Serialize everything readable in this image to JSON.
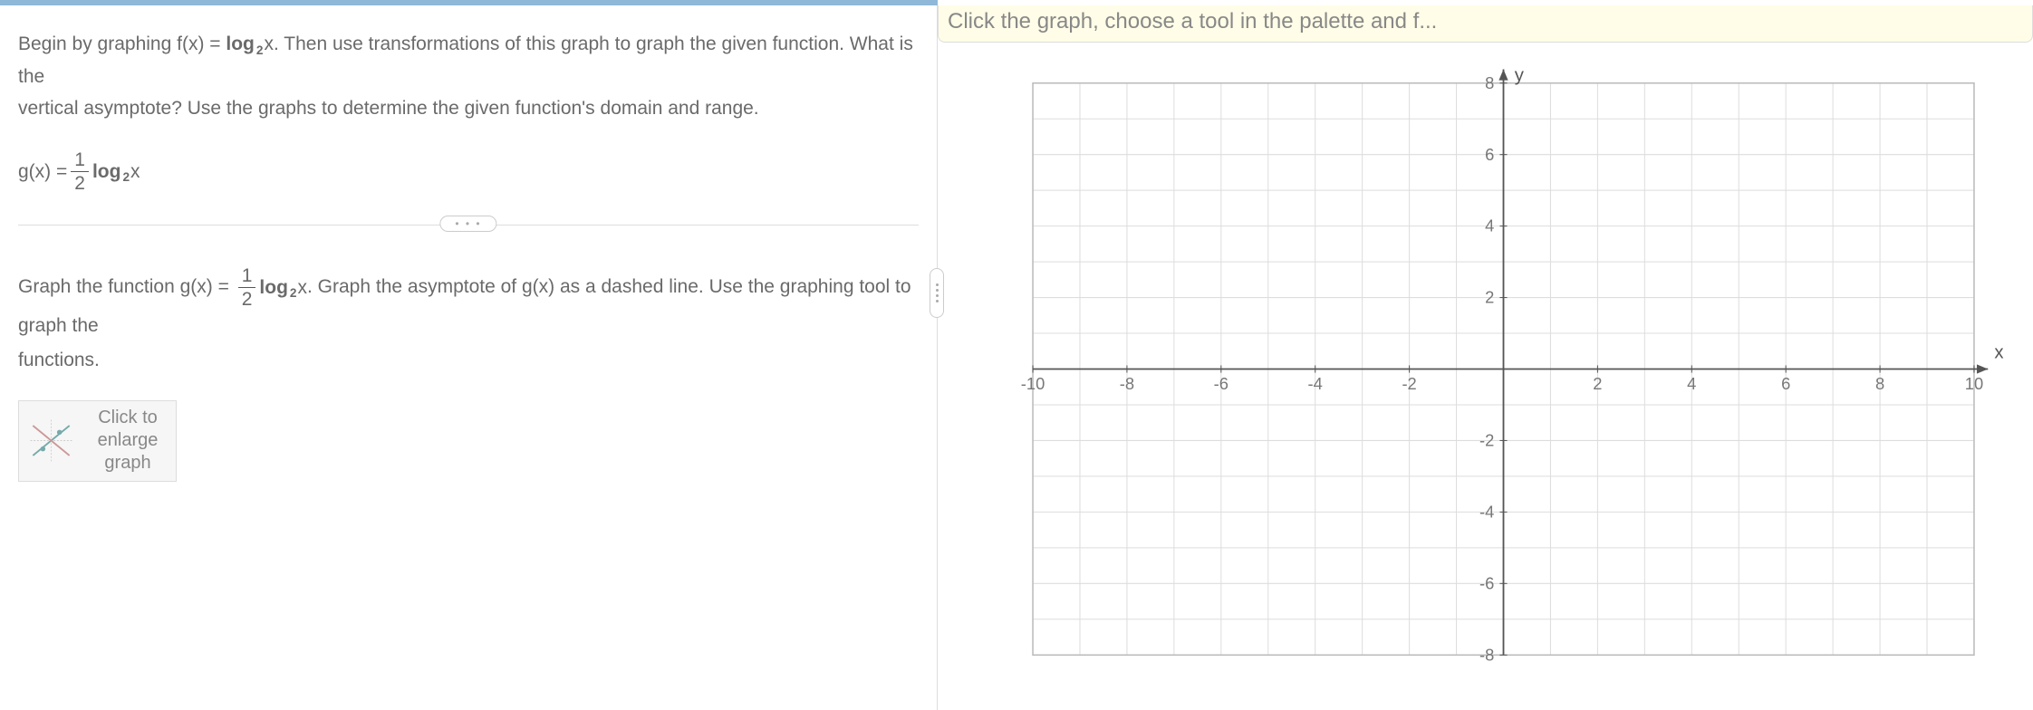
{
  "question": {
    "intro_line1": "Begin by graphing f(x) = ",
    "intro_fx_log": "log",
    "intro_fx_base": "2",
    "intro_fx_var": "x",
    "intro_line1_cont": ". Then use transformations of this graph to graph the given function. What is the",
    "intro_line2": "vertical asymptote? Use the graphs to determine the given function's domain and range.",
    "gx_lhs": "g(x) = ",
    "gx_frac_num": "1",
    "gx_frac_den": "2",
    "gx_log": "log",
    "gx_base": "2",
    "gx_var": "x"
  },
  "ellipsis": "• • •",
  "instruction": {
    "part1": "Graph the function g(x) = ",
    "frac_num": "1",
    "frac_den": "2",
    "log": "log",
    "base": "2",
    "var": "x",
    "part2": ". Graph  the asymptote of g(x) as a dashed line. Use the graphing tool to graph the",
    "part3": "functions."
  },
  "enlarge": {
    "line1": "Click to",
    "line2": "enlarge",
    "line3": "graph"
  },
  "hint": "Click the graph, choose a tool in the palette and f...",
  "graph": {
    "y_label": "y",
    "x_label": "x",
    "x_ticks": [
      "-10",
      "-8",
      "-6",
      "-4",
      "-2",
      "2",
      "4",
      "6",
      "8",
      "10"
    ],
    "y_ticks_pos": [
      "2",
      "4",
      "6",
      "8"
    ],
    "y_ticks_neg": [
      "-2",
      "-4",
      "-6",
      "-8"
    ],
    "xmin": -10,
    "xmax": 10,
    "ymin": -8,
    "ymax": 8
  }
}
